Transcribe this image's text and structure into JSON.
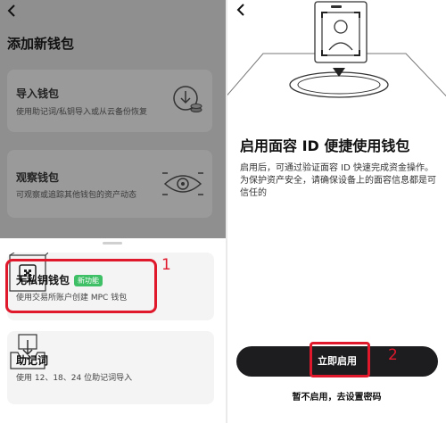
{
  "left": {
    "back_icon": "chevron-left-icon",
    "title": "添加新钱包",
    "import": {
      "title": "导入钱包",
      "subtitle": "使用助记词/私钥导入或从云备份恢复",
      "icon": "import-download-icon"
    },
    "watch": {
      "title": "观察钱包",
      "subtitle": "可观察或追踪其他钱包的资产动态",
      "icon": "eye-icon"
    },
    "keyless": {
      "title": "无私钥钱包",
      "badge": "新功能",
      "subtitle": "使用交易所账户创建 MPC 钱包",
      "icon": "mpc-chip-icon"
    },
    "mnemonic": {
      "title": "助记词",
      "subtitle": "使用 12、18、24 位助记词导入",
      "icon": "document-tray-icon"
    },
    "annotation": "1",
    "annotation_color": "#e0182c"
  },
  "right": {
    "back_icon": "chevron-left-icon",
    "illustration_icon": "face-id-phone-icon",
    "title": "启用面容 ID 便捷使用钱包",
    "description": "启用后，可通过验证面容 ID 快速完成资金操作。为保护资产安全，请确保设备上的面容信息都是可信任的",
    "enable_button": "立即启用",
    "skip_link": "暂不启用，去设置密码",
    "annotation": "2",
    "annotation_color": "#e0182c"
  }
}
